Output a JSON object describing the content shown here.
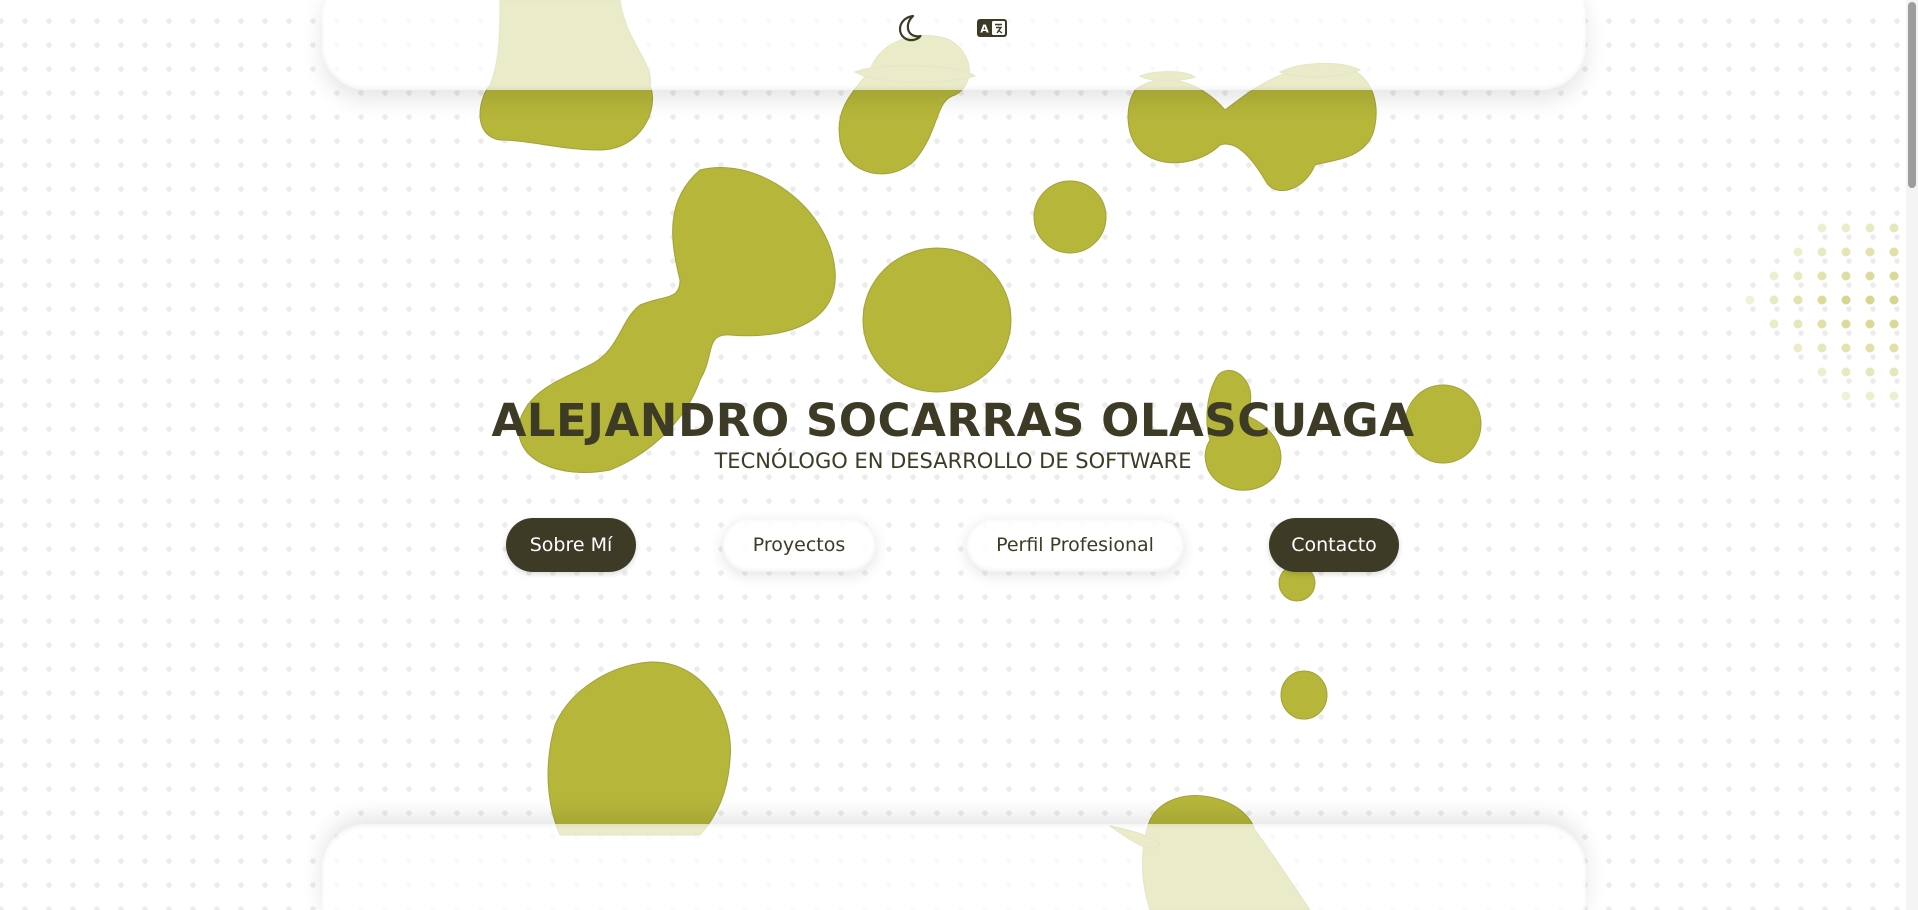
{
  "header": {
    "theme_toggle_icon": "moon-icon",
    "language_toggle_icon": "translate-icon"
  },
  "hero": {
    "name": "ALEJANDRO SOCARRAS OLASCUAGA",
    "subtitle": "TECNÓLOGO EN DESARROLLO DE SOFTWARE"
  },
  "nav": {
    "about": "Sobre Mí",
    "projects": "Proyectos",
    "profile": "Perfil Profesional",
    "contact": "Contacto"
  },
  "colors": {
    "blob": "#b5b63a",
    "primary_dark": "#3d3a26",
    "background": "#ffffff",
    "dot_pattern": "#ececec"
  }
}
